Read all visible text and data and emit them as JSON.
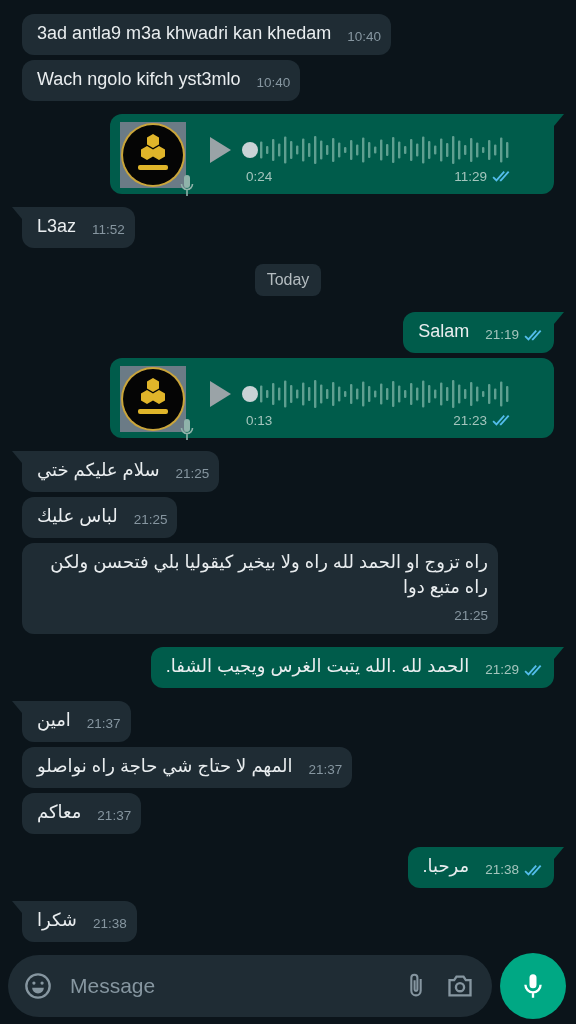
{
  "messages": [
    {
      "kind": "text",
      "outgoing": false,
      "tail": false,
      "text": "3ad antla9 m3a khwadri kan khedam",
      "time": "10:40"
    },
    {
      "kind": "text",
      "outgoing": false,
      "tail": false,
      "text": "Wach ngolo kifch yst3mlo",
      "time": "10:40"
    },
    {
      "kind": "voice",
      "outgoing": true,
      "tail": true,
      "duration": "0:24",
      "time": "11:29",
      "read": true
    },
    {
      "kind": "text",
      "outgoing": false,
      "tail": true,
      "text": "L3az",
      "time": "11:52"
    },
    {
      "kind": "date",
      "text": "Today"
    },
    {
      "kind": "text",
      "outgoing": true,
      "tail": true,
      "text": "Salam",
      "time": "21:19",
      "read": true
    },
    {
      "kind": "voice",
      "outgoing": true,
      "tail": false,
      "duration": "0:13",
      "time": "21:23",
      "read": true
    },
    {
      "kind": "text",
      "outgoing": false,
      "tail": true,
      "text": "سلام عليكم ختي",
      "time": "21:25"
    },
    {
      "kind": "text",
      "outgoing": false,
      "tail": false,
      "text": "لباس  عليك",
      "time": "21:25"
    },
    {
      "kind": "text",
      "outgoing": false,
      "tail": false,
      "text": "راه تزوج او الحمد لله راه ولا بيخير كيقوليا بلي فتحسن ولكن راه متبع دوا",
      "time": "21:25"
    },
    {
      "kind": "text",
      "outgoing": true,
      "tail": true,
      "text": "الحمد لله .الله يتبت الغرس ويجيب الشفا.",
      "time": "21:29",
      "read": true
    },
    {
      "kind": "text",
      "outgoing": false,
      "tail": true,
      "text": "امين",
      "time": "21:37"
    },
    {
      "kind": "text",
      "outgoing": false,
      "tail": false,
      "text": "المهم لا حتاج شي حاجة راه نواصلو",
      "time": "21:37"
    },
    {
      "kind": "text",
      "outgoing": false,
      "tail": false,
      "text": "معاكم",
      "time": "21:37"
    },
    {
      "kind": "text",
      "outgoing": true,
      "tail": true,
      "text": "مرحبا.",
      "time": "21:38",
      "read": true
    },
    {
      "kind": "text",
      "outgoing": false,
      "tail": true,
      "text": "شكرا",
      "time": "21:38"
    }
  ],
  "composer": {
    "placeholder": "Message"
  }
}
